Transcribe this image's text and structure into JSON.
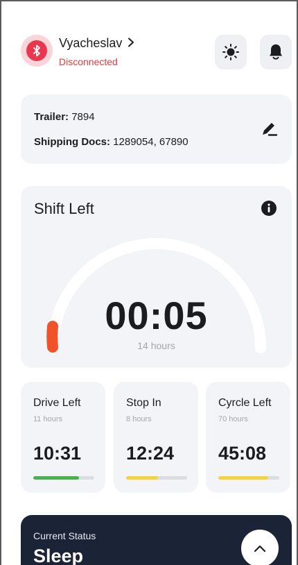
{
  "header": {
    "user_name": "Vyacheslav",
    "user_chevron": "›",
    "connection_status": "Disconnected",
    "icons": {
      "bluetooth": "bluetooth-icon",
      "theme": "sun-icon",
      "notifications": "bell-icon"
    }
  },
  "trailer": {
    "trailer_label": "Trailer:",
    "trailer_value": "7894",
    "docs_label": "Shipping Docs:",
    "docs_value": "1289054, 67890"
  },
  "shift": {
    "title": "Shift Left",
    "time": "00:05",
    "total": "14 hours",
    "progress": 0.006
  },
  "stats": [
    {
      "title": "Drive Left",
      "sub": "11 hours",
      "value": "10:31",
      "progress": 0.75,
      "color": "#4caf50"
    },
    {
      "title": "Stop In",
      "sub": "8 hours",
      "value": "12:24",
      "progress": 0.52,
      "color": "#f5d33a"
    },
    {
      "title": "Cyrcle Left",
      "sub": "70 hours",
      "value": "45:08",
      "progress": 0.82,
      "color": "#f5d33a"
    }
  ],
  "status": {
    "label": "Current Status",
    "value": "Sleep"
  },
  "colors": {
    "accent_red": "#e8384f",
    "gauge_orange": "#f0522a",
    "status_bg": "#1b2437"
  }
}
